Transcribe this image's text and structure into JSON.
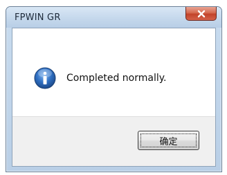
{
  "window": {
    "title": "FPWIN GR"
  },
  "icons": {
    "close": "close-icon",
    "message": "info-icon"
  },
  "message": {
    "text": "Completed normally."
  },
  "buttons": {
    "ok_label": "确定"
  },
  "colors": {
    "close_button": "#d04a2e",
    "info_icon": "#2f6fc2"
  }
}
